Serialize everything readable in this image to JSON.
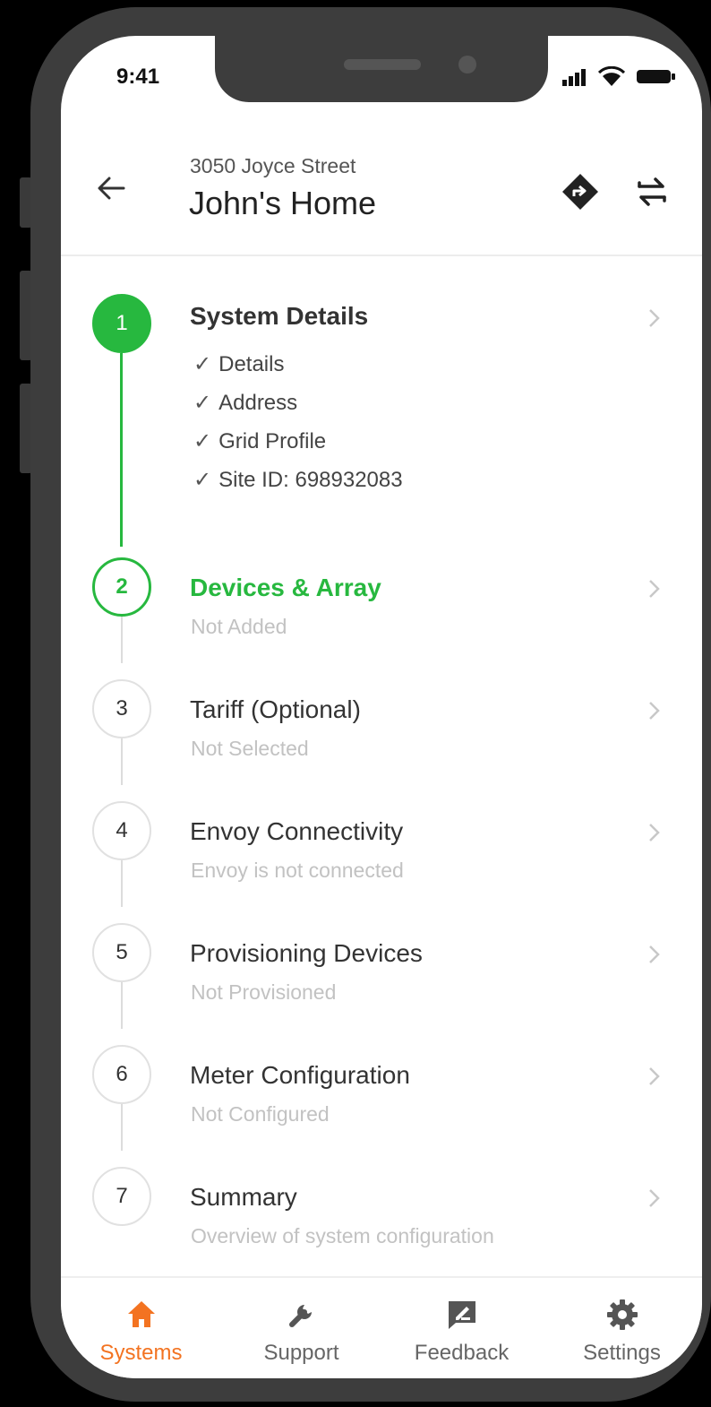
{
  "status_bar": {
    "time": "9:41"
  },
  "header": {
    "address": "3050 Joyce Street",
    "title": "John's Home"
  },
  "steps": [
    {
      "number": "1",
      "title": "System Details",
      "state": "complete",
      "checklist": [
        "Details",
        "Address",
        "Grid Profile",
        "Site ID: 698932083"
      ]
    },
    {
      "number": "2",
      "title": "Devices & Array",
      "subtitle": "Not Added",
      "state": "active"
    },
    {
      "number": "3",
      "title": "Tariff (Optional)",
      "subtitle": "Not Selected",
      "state": "pending"
    },
    {
      "number": "4",
      "title": "Envoy Connectivity",
      "subtitle": "Envoy is not connected",
      "state": "pending"
    },
    {
      "number": "5",
      "title": "Provisioning Devices",
      "subtitle": "Not Provisioned",
      "state": "pending"
    },
    {
      "number": "6",
      "title": "Meter Configuration",
      "subtitle": "Not Configured",
      "state": "pending"
    },
    {
      "number": "7",
      "title": "Summary",
      "subtitle": "Overview of system configuration",
      "state": "pending"
    }
  ],
  "tabs": [
    {
      "label": "Systems",
      "icon": "home-icon",
      "selected": true
    },
    {
      "label": "Support",
      "icon": "wrench-icon",
      "selected": false
    },
    {
      "label": "Feedback",
      "icon": "feedback-icon",
      "selected": false
    },
    {
      "label": "Settings",
      "icon": "gear-icon",
      "selected": false
    }
  ],
  "colors": {
    "accent_green": "#27b83f",
    "accent_orange": "#f37321",
    "phone_frame": "#3d3d3d"
  }
}
